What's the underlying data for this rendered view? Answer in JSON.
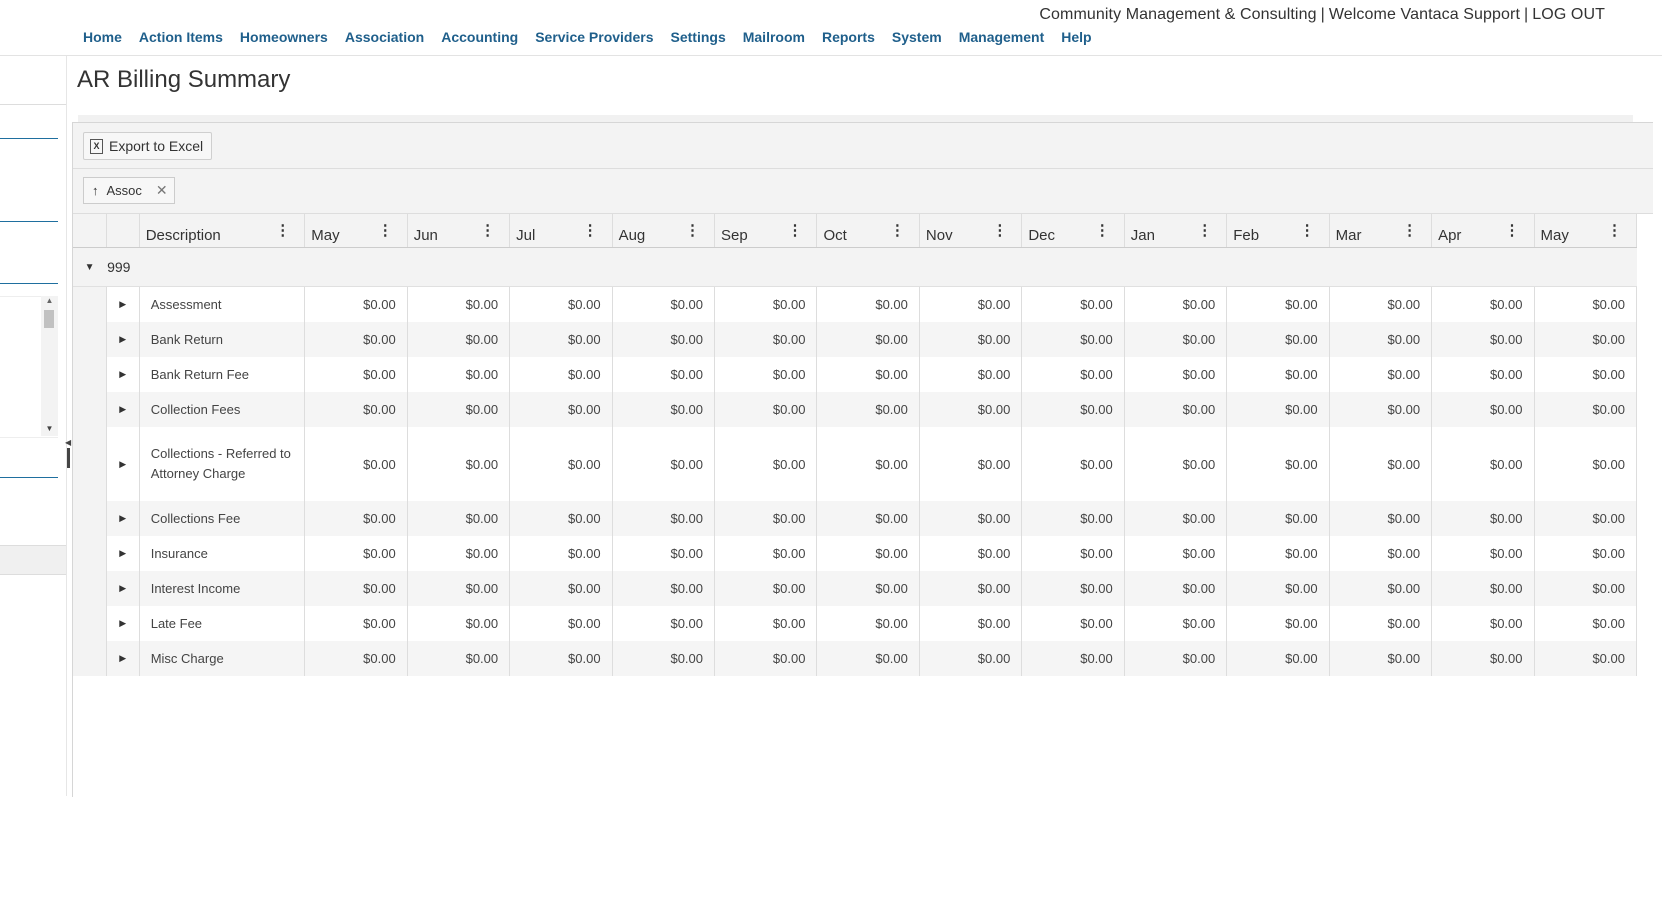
{
  "header": {
    "company": "Community Management & Consulting",
    "welcome": "Welcome Vantaca Support",
    "logout": "LOG OUT"
  },
  "nav": [
    "Home",
    "Action Items",
    "Homeowners",
    "Association",
    "Accounting",
    "Service Providers",
    "Settings",
    "Mailroom",
    "Reports",
    "System",
    "Management",
    "Help"
  ],
  "page": {
    "title": "AR Billing Summary"
  },
  "toolbar": {
    "export_label": "Export to Excel"
  },
  "group_chip": {
    "label": "Assoc"
  },
  "columns": [
    "Description",
    "May",
    "Jun",
    "Jul",
    "Aug",
    "Sep",
    "Oct",
    "Nov",
    "Dec",
    "Jan",
    "Feb",
    "Mar",
    "Apr",
    "May"
  ],
  "group": {
    "label": "999"
  },
  "rows": [
    {
      "desc": "Assessment",
      "values": [
        "$0.00",
        "$0.00",
        "$0.00",
        "$0.00",
        "$0.00",
        "$0.00",
        "$0.00",
        "$0.00",
        "$0.00",
        "$0.00",
        "$0.00",
        "$0.00",
        "$0.00"
      ]
    },
    {
      "desc": "Bank Return",
      "values": [
        "$0.00",
        "$0.00",
        "$0.00",
        "$0.00",
        "$0.00",
        "$0.00",
        "$0.00",
        "$0.00",
        "$0.00",
        "$0.00",
        "$0.00",
        "$0.00",
        "$0.00"
      ]
    },
    {
      "desc": "Bank Return Fee",
      "values": [
        "$0.00",
        "$0.00",
        "$0.00",
        "$0.00",
        "$0.00",
        "$0.00",
        "$0.00",
        "$0.00",
        "$0.00",
        "$0.00",
        "$0.00",
        "$0.00",
        "$0.00"
      ]
    },
    {
      "desc": "Collection Fees",
      "values": [
        "$0.00",
        "$0.00",
        "$0.00",
        "$0.00",
        "$0.00",
        "$0.00",
        "$0.00",
        "$0.00",
        "$0.00",
        "$0.00",
        "$0.00",
        "$0.00",
        "$0.00"
      ]
    },
    {
      "desc": "Collections - Referred to Attorney Charge",
      "values": [
        "$0.00",
        "$0.00",
        "$0.00",
        "$0.00",
        "$0.00",
        "$0.00",
        "$0.00",
        "$0.00",
        "$0.00",
        "$0.00",
        "$0.00",
        "$0.00",
        "$0.00"
      ]
    },
    {
      "desc": "Collections Fee",
      "values": [
        "$0.00",
        "$0.00",
        "$0.00",
        "$0.00",
        "$0.00",
        "$0.00",
        "$0.00",
        "$0.00",
        "$0.00",
        "$0.00",
        "$0.00",
        "$0.00",
        "$0.00"
      ]
    },
    {
      "desc": "Insurance",
      "values": [
        "$0.00",
        "$0.00",
        "$0.00",
        "$0.00",
        "$0.00",
        "$0.00",
        "$0.00",
        "$0.00",
        "$0.00",
        "$0.00",
        "$0.00",
        "$0.00",
        "$0.00"
      ]
    },
    {
      "desc": "Interest Income",
      "values": [
        "$0.00",
        "$0.00",
        "$0.00",
        "$0.00",
        "$0.00",
        "$0.00",
        "$0.00",
        "$0.00",
        "$0.00",
        "$0.00",
        "$0.00",
        "$0.00",
        "$0.00"
      ]
    },
    {
      "desc": "Late Fee",
      "values": [
        "$0.00",
        "$0.00",
        "$0.00",
        "$0.00",
        "$0.00",
        "$0.00",
        "$0.00",
        "$0.00",
        "$0.00",
        "$0.00",
        "$0.00",
        "$0.00",
        "$0.00"
      ]
    },
    {
      "desc": "Misc Charge",
      "values": [
        "$0.00",
        "$0.00",
        "$0.00",
        "$0.00",
        "$0.00",
        "$0.00",
        "$0.00",
        "$0.00",
        "$0.00",
        "$0.00",
        "$0.00",
        "$0.00",
        "$0.00"
      ]
    }
  ]
}
